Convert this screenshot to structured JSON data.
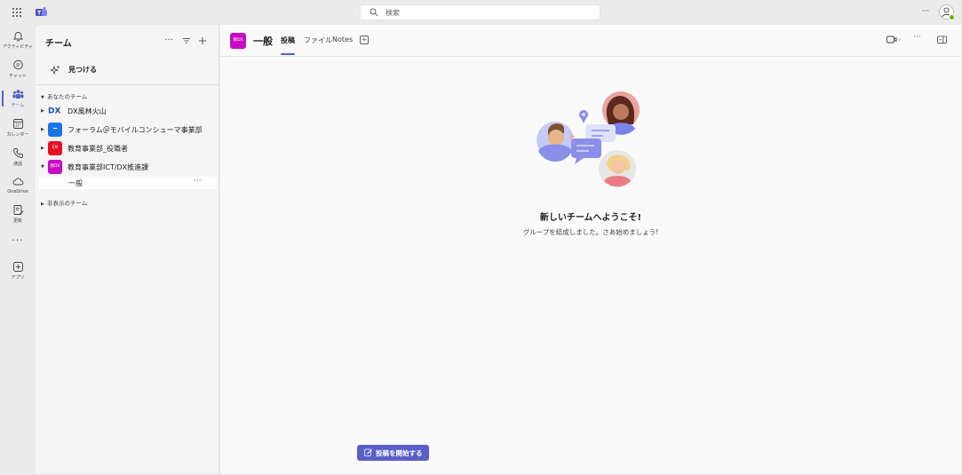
{
  "topbar": {
    "search_placeholder": "検索",
    "more_label": "···"
  },
  "rail": {
    "items": [
      {
        "label": "アクティビティ",
        "icon": "bell-icon"
      },
      {
        "label": "チャット",
        "icon": "chat-icon"
      },
      {
        "label": "チーム",
        "icon": "teams-icon"
      },
      {
        "label": "カレンダー",
        "icon": "calendar-icon"
      },
      {
        "label": "通話",
        "icon": "phone-icon"
      },
      {
        "label": "OneDrive",
        "icon": "cloud-icon"
      },
      {
        "label": "更新",
        "icon": "update-icon"
      }
    ],
    "more": "···",
    "apps_label": "アプリ"
  },
  "pane": {
    "title": "チーム",
    "more": "···",
    "discover_label": "見つける",
    "your_teams_label": "あなたのチーム",
    "hidden_teams_label": "非表示のチーム",
    "teams": [
      {
        "name": "DX風林火山",
        "avatar_text": "DX",
        "color": "#1f4ea8"
      },
      {
        "name": "フォーラム＠モバイルコンシューマ事業部",
        "avatar_text": "",
        "color": "#1a73e8"
      },
      {
        "name": "教育事業部_役職者",
        "avatar_text": "EM",
        "color": "#e81123"
      },
      {
        "name": "教育事業部ICT/DX推進課",
        "avatar_text": "教DX",
        "color": "#c80ac2"
      }
    ],
    "channel": {
      "name": "一般",
      "more": "···"
    }
  },
  "main": {
    "channel_avatar_text": "教DX",
    "channel_title": "一般",
    "tabs": [
      {
        "label": "投稿"
      },
      {
        "label": "ファイル"
      },
      {
        "label": "Notes"
      }
    ],
    "welcome_title": "新しいチームへようこそ!",
    "welcome_sub": "グループを結成しました。さあ始めましょう!",
    "start_post_label": "投稿を開始する",
    "header_more": "···"
  },
  "colors": {
    "accent": "#5b5fc7",
    "channel_avatar": "#c80ac2"
  }
}
